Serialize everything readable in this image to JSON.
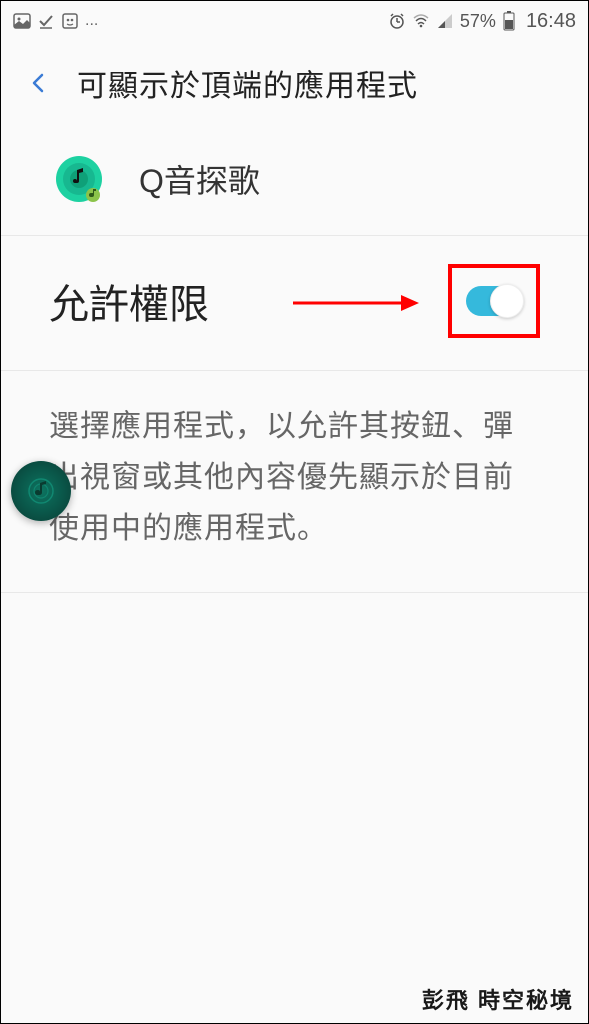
{
  "status_bar": {
    "battery_text": "57%",
    "time": "16:48",
    "ellipsis": "..."
  },
  "header": {
    "title": "可顯示於頂端的應用程式"
  },
  "app": {
    "name": "Q音探歌",
    "icon_name": "music-app-icon"
  },
  "permission": {
    "label": "允許權限",
    "toggle_state": true
  },
  "description": "選擇應用程式，以允許其按鈕、彈出視窗或其他內容優先顯示於目前使用中的應用程式。",
  "watermark": "彭飛 時空秘境",
  "colors": {
    "toggle_on": "#35b9dc",
    "annotation": "#ff0000"
  }
}
